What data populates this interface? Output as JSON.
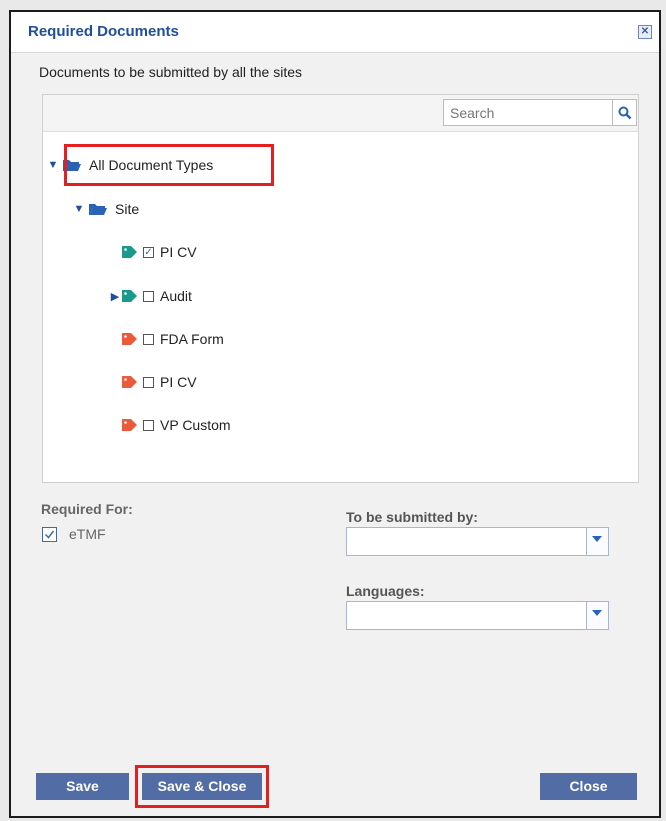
{
  "dialog": {
    "title": "Required Documents",
    "close_icon": "close-icon",
    "subtitle": "Documents to be submitted by all the sites"
  },
  "search": {
    "placeholder": "Search",
    "icon": "search-icon"
  },
  "tree": {
    "root": {
      "label": "All Document Types",
      "expanded": true,
      "highlighted": true
    },
    "site": {
      "label": "Site",
      "expanded": true
    },
    "items": [
      {
        "label": "PI CV",
        "tag_color": "#1a9a8c",
        "checked": true,
        "has_children": false
      },
      {
        "label": "Audit",
        "tag_color": "#1a9a8c",
        "checked": false,
        "has_children": true
      },
      {
        "label": "FDA Form",
        "tag_color": "#ea5a3b",
        "checked": false,
        "has_children": false
      },
      {
        "label": "PI CV",
        "tag_color": "#ea5a3b",
        "checked": false,
        "has_children": false
      },
      {
        "label": "VP Custom",
        "tag_color": "#ea5a3b",
        "checked": false,
        "has_children": false
      }
    ]
  },
  "required_for": {
    "label": "Required For:",
    "option": "eTMF",
    "checked": true
  },
  "submitted_by": {
    "label": "To be submitted by:",
    "value": ""
  },
  "languages": {
    "label": "Languages:",
    "value": ""
  },
  "footer": {
    "save": "Save",
    "save_close": "Save & Close",
    "close": "Close"
  },
  "colors": {
    "title": "#1f4e9c",
    "button": "#526da5",
    "highlight": "#e41f1f",
    "teal_tag": "#1a9a8c",
    "red_tag": "#ea5a3b"
  }
}
